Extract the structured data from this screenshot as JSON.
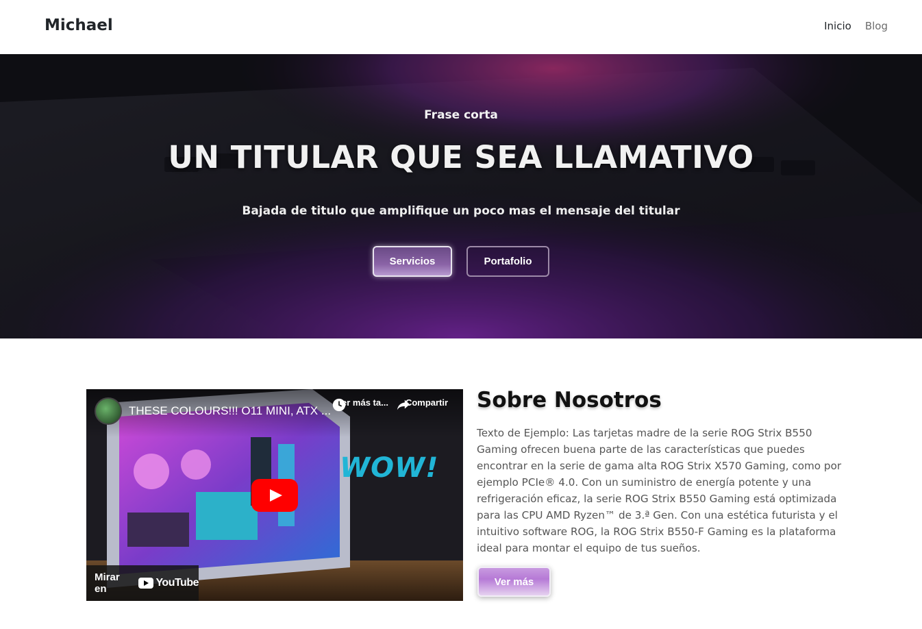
{
  "navbar": {
    "brand": "Michael",
    "links": [
      {
        "label": "Inicio"
      },
      {
        "label": "Blog"
      }
    ]
  },
  "hero": {
    "kicker": "Frase corta",
    "title": "UN TITULAR QUE SEA LLAMATIVO",
    "subtitle": "Bajada de titulo que amplifique un poco mas el mensaje del titular",
    "buttons": {
      "primary": "Servicios",
      "secondary": "Portafolio"
    }
  },
  "video": {
    "title": "THESE COLOURS!!! O11 MINI, ATX ...",
    "watch_later": "Ver más ta...",
    "share": "Compartir",
    "watch_on": "Mirar en",
    "platform": "YouTube",
    "thumbnail_text": "WOW!"
  },
  "about": {
    "title": "Sobre Nosotros",
    "text": "Texto de Ejemplo: Las tarjetas madre de la serie ROG Strix B550 Gaming ofrecen buena parte de las características que puedes encontrar en la serie de gama alta ROG Strix X570 Gaming, como por ejemplo PCIe® 4.0. Con un suministro de energía potente y una refrigeración eficaz, la serie ROG Strix B550 Gaming está optimizada para las CPU AMD Ryzen™ de 3.ª Gen. Con una estética futurista y el intuitivo software ROG, la ROG Strix B550-F Gaming es la plataforma ideal para montar el equipo de tus sueños.",
    "button": "Ver más"
  },
  "colors": {
    "accent": "#8a63a6",
    "youtube_red": "#ff0000",
    "wow": "#21b5d6"
  }
}
